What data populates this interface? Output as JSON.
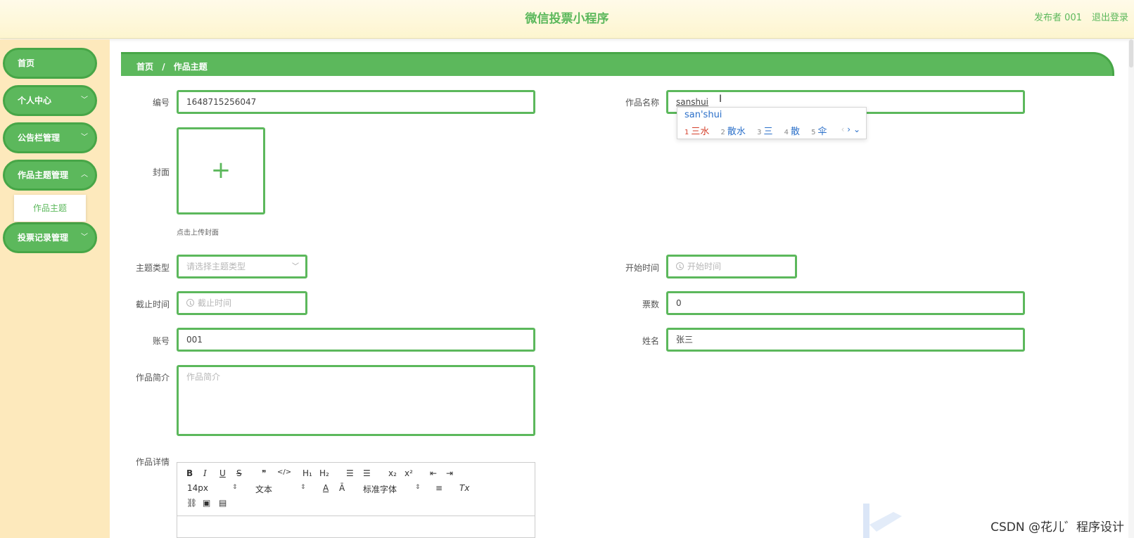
{
  "header": {
    "title": "微信投票小程序",
    "user": "发布者 001",
    "logout": "退出登录"
  },
  "sidebar": {
    "items": [
      {
        "label": "首页"
      },
      {
        "label": "个人中心"
      },
      {
        "label": "公告栏管理"
      },
      {
        "label": "作品主题管理"
      },
      {
        "label": "投票记录管理"
      }
    ],
    "sub_item": "作品主题"
  },
  "breadcrumb": {
    "home": "首页",
    "separator": "/",
    "current": "作品主题"
  },
  "form": {
    "code_label": "编号",
    "code_value": "1648715256047",
    "name_label": "作品名称",
    "name_value": "sanshui",
    "cover_label": "封面",
    "cover_hint": "点击上传封面",
    "type_label": "主题类型",
    "type_placeholder": "请选择主题类型",
    "start_label": "开始时间",
    "start_placeholder": "开始时间",
    "end_label": "截止时间",
    "end_placeholder": "截止时间",
    "votes_label": "票数",
    "votes_value": "0",
    "account_label": "账号",
    "account_value": "001",
    "username_label": "姓名",
    "username_value": "张三",
    "intro_label": "作品简介",
    "intro_placeholder": "作品简介",
    "detail_label": "作品详情"
  },
  "ime": {
    "pinyin": "san'shui",
    "candidates": [
      {
        "index": "1",
        "text": "三水"
      },
      {
        "index": "2",
        "text": "散水"
      },
      {
        "index": "3",
        "text": "三"
      },
      {
        "index": "4",
        "text": "散"
      },
      {
        "index": "5",
        "text": "伞"
      }
    ]
  },
  "editor": {
    "font_size": "14px",
    "block_type": "文本",
    "font_family": "标准字体",
    "buttons": {
      "bold": "B",
      "italic": "I",
      "underline": "U",
      "strike": "S",
      "quote": "❞",
      "code": "</>",
      "h1": "H₁",
      "h2": "H₂",
      "sub": "x₂",
      "sup": "x²",
      "clear": "Tx"
    }
  },
  "watermark": "CSDN @花儿゛程序设计",
  "colors": {
    "accent": "#5cb85c",
    "sidebar_bg": "#fde9bc",
    "header_bg": "#fdf5cf"
  }
}
